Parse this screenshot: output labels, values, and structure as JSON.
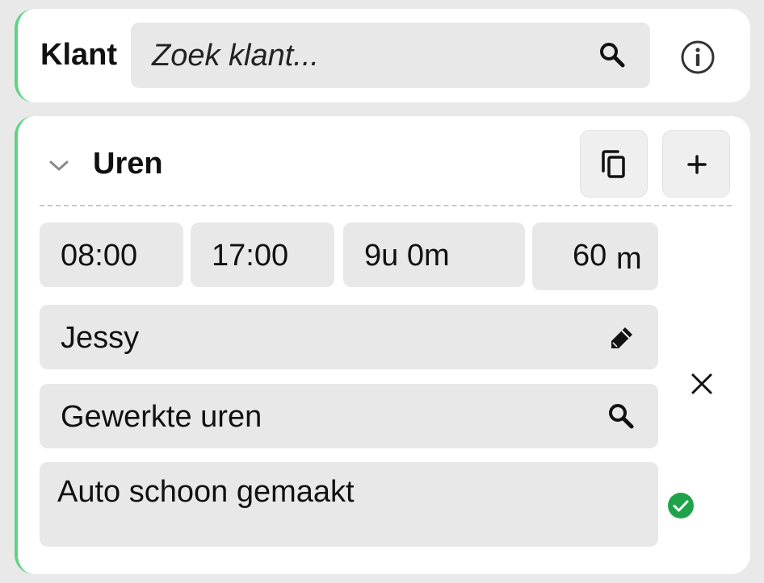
{
  "klant": {
    "label": "Klant",
    "search_placeholder": "Zoek klant..."
  },
  "uren": {
    "title": "Uren",
    "start_time": "08:00",
    "end_time": "17:00",
    "duration": "9u 0m",
    "break_value": "60",
    "break_unit": "m",
    "person": "Jessy",
    "work_type": "Gewerkte uren",
    "note": "Auto schoon gemaakt"
  },
  "colors": {
    "accent": "#5fd383",
    "check": "#1fa34a"
  },
  "icons": [
    "search-icon",
    "info-icon",
    "chevron-down-icon",
    "copy-icon",
    "plus-icon",
    "pencil-icon",
    "close-icon",
    "check-circle-icon"
  ]
}
